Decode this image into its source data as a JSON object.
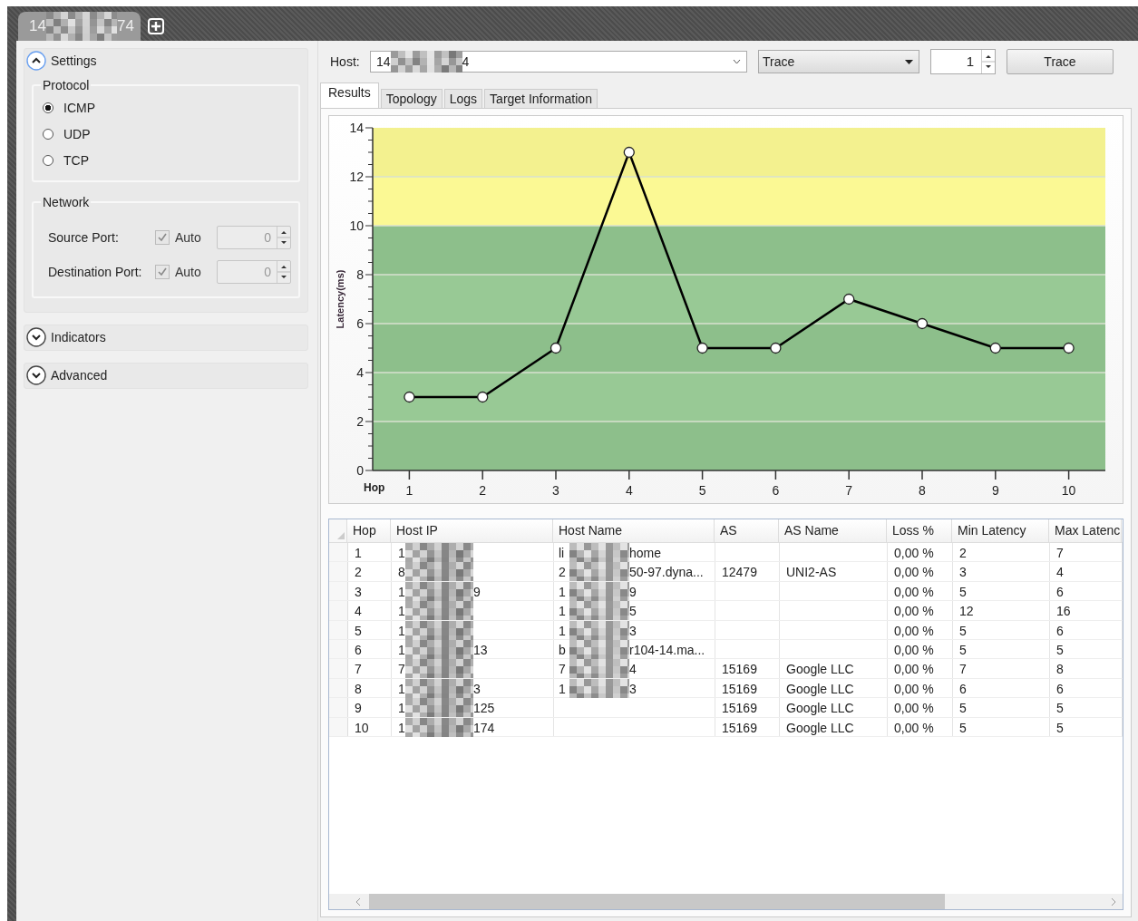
{
  "window_tabs": [
    {
      "label_start": "14",
      "label_end": "74",
      "selected": true
    }
  ],
  "sections": [
    {
      "title": "Settings",
      "expanded": true,
      "protocol": {
        "title": "Protocol",
        "options": [
          {
            "label": "ICMP",
            "selected": true
          },
          {
            "label": "UDP",
            "selected": false
          },
          {
            "label": "TCP",
            "selected": false
          }
        ]
      },
      "network": {
        "title": "Network",
        "rows": [
          {
            "label": "Source Port:",
            "auto_label": "Auto",
            "auto_checked": true,
            "value": "0"
          },
          {
            "label": "Destination Port:",
            "auto_label": "Auto",
            "auto_checked": true,
            "value": "0"
          }
        ]
      }
    },
    {
      "title": "Indicators",
      "expanded": false
    },
    {
      "title": "Advanced",
      "expanded": false
    }
  ],
  "host": {
    "label": "Host:",
    "value_start": "14",
    "value_end": "4"
  },
  "mode": {
    "value": "Trace"
  },
  "count": {
    "value": "1"
  },
  "trace_button": "Trace",
  "result_tabs": [
    {
      "label": "Results",
      "selected": true
    },
    {
      "label": "Topology",
      "selected": false
    },
    {
      "label": "Logs",
      "selected": false
    },
    {
      "label": "Target Information",
      "selected": false
    }
  ],
  "chart": {
    "chart_data": {
      "type": "line",
      "xlabel": "Hop",
      "ylabel": "Latency(ms)",
      "x": [
        1,
        2,
        3,
        4,
        5,
        6,
        7,
        8,
        9,
        10
      ],
      "series": [
        {
          "color": "#000000",
          "marker": "circle",
          "values": [
            3,
            3,
            5,
            13,
            5,
            5,
            7,
            6,
            5,
            5
          ]
        }
      ],
      "bands": [
        {
          "axis": "y",
          "from": 0,
          "to": 2,
          "color": "#8dbf8b"
        },
        {
          "axis": "y",
          "from": 2,
          "to": 4,
          "color": "#98c995"
        },
        {
          "axis": "y",
          "from": 4,
          "to": 6,
          "color": "#8dbf8b"
        },
        {
          "axis": "y",
          "from": 6,
          "to": 8,
          "color": "#98c995"
        },
        {
          "axis": "y",
          "from": 8,
          "to": 10,
          "color": "#8dbf8b"
        },
        {
          "axis": "y",
          "from": 10,
          "to": 12,
          "color": "#fbf994"
        },
        {
          "axis": "y",
          "from": 12,
          "to": 14,
          "color": "#f3f18f"
        }
      ],
      "grid": true,
      "xlim": [
        0.5,
        10.5
      ],
      "ylim": [
        0,
        14
      ],
      "yticks": [
        0,
        2,
        4,
        6,
        8,
        10,
        12,
        14
      ],
      "xticks": [
        1,
        2,
        3,
        4,
        5,
        6,
        7,
        8,
        9,
        10
      ]
    }
  },
  "table": {
    "columns": [
      "Hop",
      "Host IP",
      "Host Name",
      "AS",
      "AS Name",
      "Loss %",
      "Min Latency",
      "Max Latenc"
    ],
    "rows": [
      {
        "hop": "1",
        "host_ip": [
          "1"
        ],
        "host_name": [
          "li",
          "home"
        ],
        "loss": "0,00 %",
        "min_latency": "2",
        "max_latency": "7"
      },
      {
        "hop": "2",
        "host_ip": [
          "8"
        ],
        "host_name": [
          "2",
          "50-97.dyna..."
        ],
        "as": "12479",
        "as_name": "UNI2-AS",
        "loss": "0,00 %",
        "min_latency": "3",
        "max_latency": "4"
      },
      {
        "hop": "3",
        "host_ip": [
          "1",
          "9"
        ],
        "host_name": [
          "1",
          "9"
        ],
        "loss": "0,00 %",
        "min_latency": "5",
        "max_latency": "6"
      },
      {
        "hop": "4",
        "host_ip": [
          "1"
        ],
        "host_name": [
          "1",
          "5"
        ],
        "loss": "0,00 %",
        "min_latency": "12",
        "max_latency": "16"
      },
      {
        "hop": "5",
        "host_ip": [
          "1"
        ],
        "host_name": [
          "1",
          "3"
        ],
        "loss": "0,00 %",
        "min_latency": "5",
        "max_latency": "6"
      },
      {
        "hop": "6",
        "host_ip": [
          "1",
          "13"
        ],
        "host_name": [
          "b",
          "r104-14.ma..."
        ],
        "loss": "0,00 %",
        "min_latency": "5",
        "max_latency": "5"
      },
      {
        "hop": "7",
        "host_ip": [
          "7"
        ],
        "host_name": [
          "7",
          "4"
        ],
        "as": "15169",
        "as_name": "Google LLC",
        "loss": "0,00 %",
        "min_latency": "7",
        "max_latency": "8"
      },
      {
        "hop": "8",
        "host_ip": [
          "1",
          "3"
        ],
        "host_name": [
          "1",
          "3"
        ],
        "as": "15169",
        "as_name": "Google LLC",
        "loss": "0,00 %",
        "min_latency": "6",
        "max_latency": "6"
      },
      {
        "hop": "9",
        "host_ip": [
          "1",
          "125"
        ],
        "as": "15169",
        "as_name": "Google LLC",
        "loss": "0,00 %",
        "min_latency": "5",
        "max_latency": "5"
      },
      {
        "hop": "10",
        "host_ip": [
          "1",
          "174"
        ],
        "as": "15169",
        "as_name": "Google LLC",
        "loss": "0,00 %",
        "min_latency": "5",
        "max_latency": "5"
      }
    ]
  }
}
